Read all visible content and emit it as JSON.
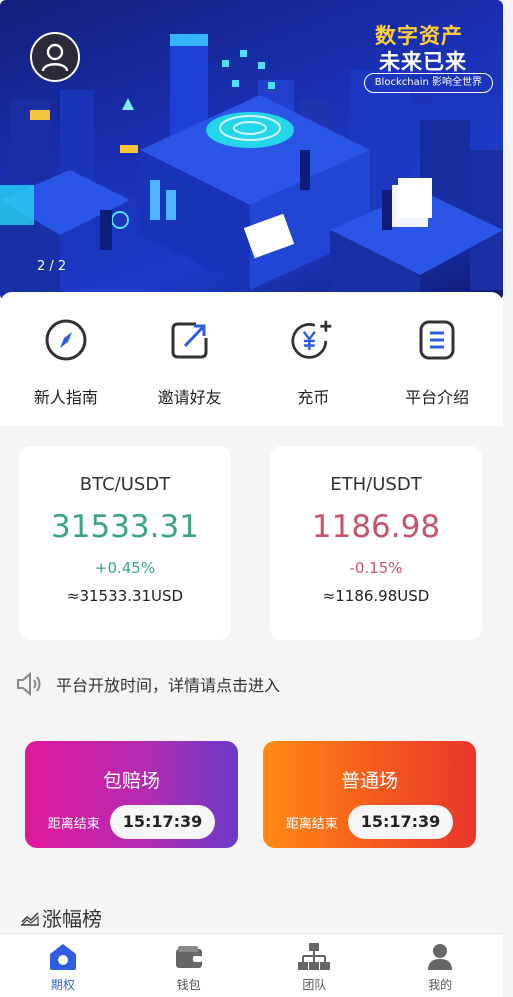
{
  "banner": {
    "title_line1": "数字资产",
    "title_line2": "未来已来",
    "tag": "Blockchain 影响全世界",
    "counter": "2 / 2"
  },
  "quick_actions": [
    {
      "label": "新人指南",
      "icon": "compass-icon"
    },
    {
      "label": "邀请好友",
      "icon": "share-arrow-icon"
    },
    {
      "label": "充币",
      "icon": "deposit-coin-icon"
    },
    {
      "label": "平台介绍",
      "icon": "intro-doc-icon"
    }
  ],
  "tickers": [
    {
      "pair": "BTC/USDT",
      "price": "31533.31",
      "change": "+0.45%",
      "usd": "≈31533.31USD",
      "trend": "up"
    },
    {
      "pair": "ETH/USDT",
      "price": "1186.98",
      "change": "-0.15%",
      "usd": "≈1186.98USD",
      "trend": "down"
    }
  ],
  "notice": {
    "text": "平台开放时间，详情请点击进入",
    "icon": "speaker-icon"
  },
  "markets": [
    {
      "title": "包赔场",
      "countdown_label": "距离结束",
      "countdown": "15:17:39"
    },
    {
      "title": "普通场",
      "countdown_label": "距离结束",
      "countdown": "15:17:39"
    }
  ],
  "ranking": {
    "title": "涨幅榜",
    "icon": "trend-chart-icon"
  },
  "bottom_nav": [
    {
      "label": "期权",
      "icon": "home-icon",
      "active": true
    },
    {
      "label": "钱包",
      "icon": "wallet-icon",
      "active": false
    },
    {
      "label": "团队",
      "icon": "team-tree-icon",
      "active": false
    },
    {
      "label": "我的",
      "icon": "user-icon",
      "active": false
    }
  ],
  "colors": {
    "up": "#3aa67e",
    "down": "#c9546a",
    "active_nav": "#2f5fe0",
    "icon_stroke": "#333333"
  }
}
